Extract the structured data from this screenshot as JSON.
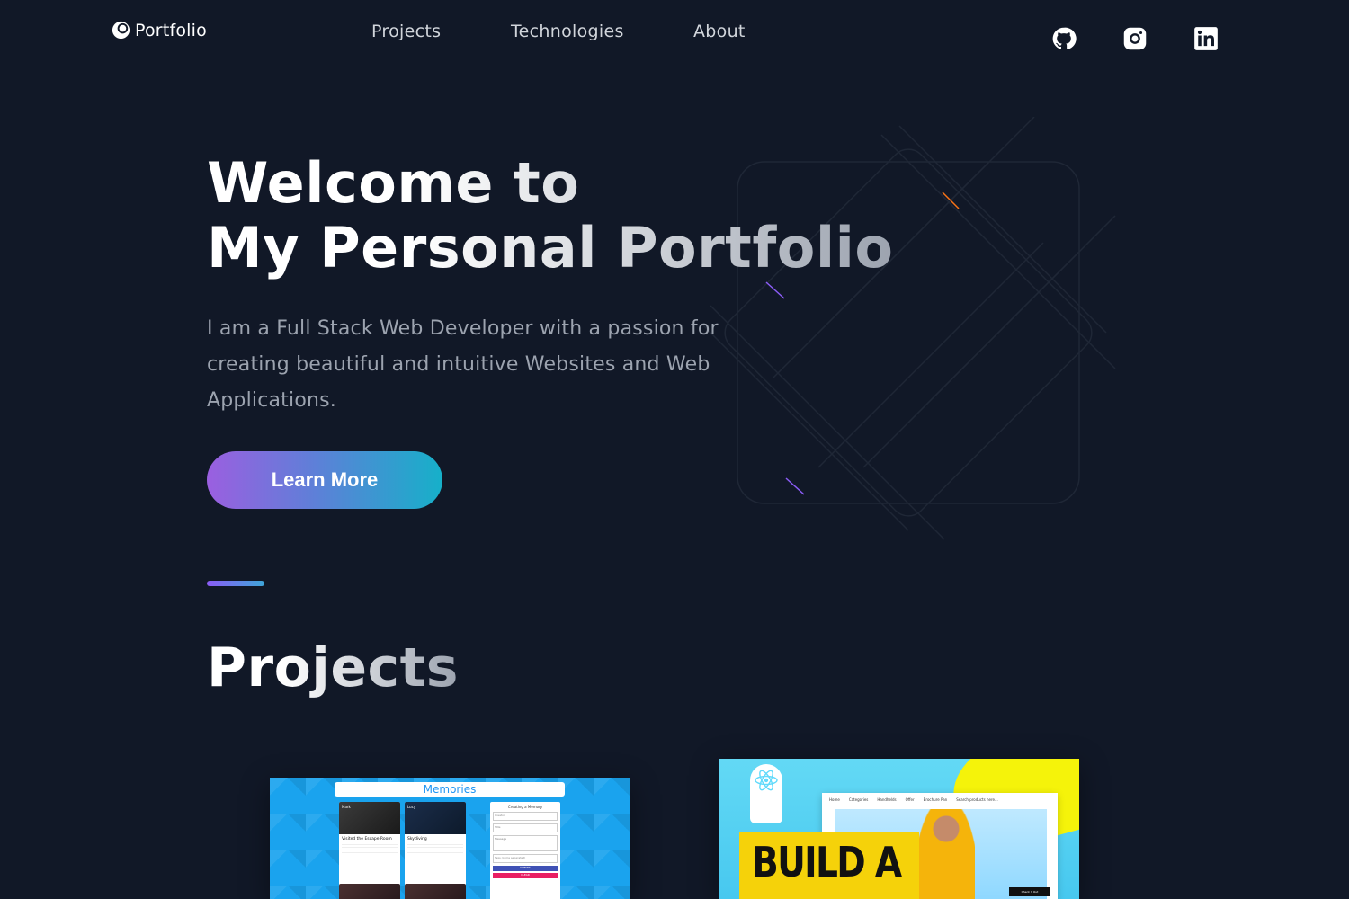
{
  "nav": {
    "brand": "Portfolio",
    "links": [
      "Projects",
      "Technologies",
      "About"
    ],
    "social": [
      "github-icon",
      "instagram-icon",
      "linkedin-icon"
    ]
  },
  "hero": {
    "title_line1": "Welcome to",
    "title_line2": "My Personal Portfolio",
    "description": "I am a Full Stack Web Developer with a passion for creating beautiful and intuitive Websites and Web Applications.",
    "cta_label": "Learn More"
  },
  "projects": {
    "title": "Projects",
    "cards": [
      {
        "app_title": "Memories",
        "posts": [
          {
            "author": "Mark",
            "title": "Visited the Escape Room"
          },
          {
            "author": "Lucy",
            "title": "Skydiving"
          }
        ],
        "form_title": "Creating a Memory",
        "form_fields": [
          "Creator",
          "Title",
          "Message",
          "Tags (coma separated)"
        ],
        "submit_label": "SUBMIT",
        "clear_label": "CLEAR"
      },
      {
        "headline": "BUILD A",
        "site_nav": [
          "Home",
          "Categories",
          "Handhelds",
          "Offer",
          "Brochure Pan"
        ],
        "site_search": "Search products here...",
        "site_cta": "Check It Out"
      }
    ]
  },
  "colors": {
    "background": "#111827",
    "cta_gradient_start": "#9b5fe0",
    "cta_gradient_end": "#16b0c9",
    "text_muted": "#9ca3af"
  }
}
